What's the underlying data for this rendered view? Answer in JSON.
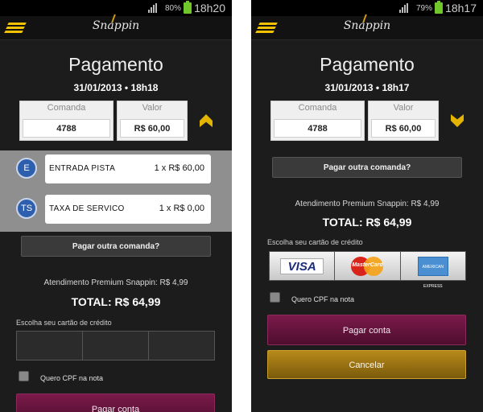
{
  "left": {
    "status": {
      "battery_pct": "80%",
      "time": "18h20"
    },
    "logo": "Snappin",
    "title": "Pagamento",
    "date": "31/01/2013 • 18h18",
    "comanda_label": "Comanda",
    "comanda_value": "4788",
    "valor_label": "Valor",
    "valor_value": "R$ 60,00",
    "items": [
      {
        "badge": "E",
        "name": "ENTRADA PISTA",
        "amount": "1 x R$ 60,00"
      },
      {
        "badge": "TS",
        "name": "TAXA DE SERVICO",
        "amount": "1 x R$ 0,00"
      }
    ],
    "other_button": "Pagar outra comanda?",
    "premium": "Atendimento Premium Snappin: R$ 4,99",
    "total": "TOTAL: R$ 64,99",
    "choose_card": "Escolha seu cartão de crédito",
    "cpf_label": "Quero CPF na nota",
    "pay_button": "Pagar conta"
  },
  "right": {
    "status": {
      "battery_pct": "79%",
      "time": "18h17"
    },
    "logo": "Snappin",
    "title": "Pagamento",
    "date": "31/01/2013 • 18h17",
    "comanda_label": "Comanda",
    "comanda_value": "4788",
    "valor_label": "Valor",
    "valor_value": "R$ 60,00",
    "other_button": "Pagar outra comanda?",
    "premium": "Atendimento Premium Snappin: R$ 4,99",
    "total": "TOTAL: R$ 64,99",
    "choose_card": "Escolha seu cartão de crédito",
    "cards": {
      "visa": "VISA",
      "mastercard": "MasterCard",
      "amex": "AMERICAN EXPRESS"
    },
    "cpf_label": "Quero CPF na nota",
    "pay_button": "Pagar conta",
    "cancel_button": "Cancelar"
  },
  "colors": {
    "accent": "#e3b400",
    "pay": "#6a1640",
    "cancel": "#a67c14",
    "badge": "#2e5faf"
  }
}
